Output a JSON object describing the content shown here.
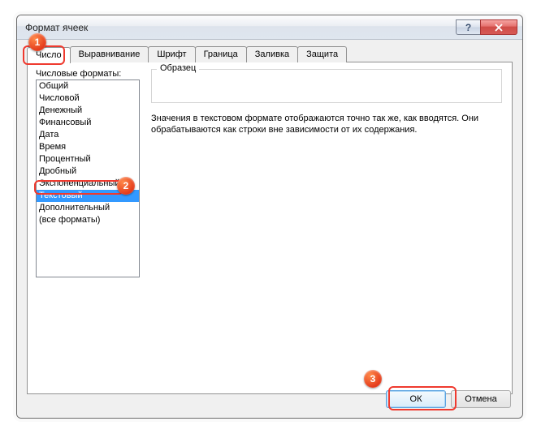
{
  "window": {
    "title": "Формат ячеек",
    "help_char": "?"
  },
  "tabs": {
    "t0": "Число",
    "t1": "Выравнивание",
    "t2": "Шрифт",
    "t3": "Граница",
    "t4": "Заливка",
    "t5": "Защита"
  },
  "formats_label": "Числовые форматы:",
  "formats": {
    "f0": "Общий",
    "f1": "Числовой",
    "f2": "Денежный",
    "f3": "Финансовый",
    "f4": "Дата",
    "f5": "Время",
    "f6": "Процентный",
    "f7": "Дробный",
    "f8": "Экспоненциальный",
    "f9": "Текстовый",
    "f10": "Дополнительный",
    "f11": "(все форматы)"
  },
  "sample_label": "Образец",
  "description": "Значения в текстовом формате отображаются точно так же, как вводятся. Они обрабатываются как строки вне зависимости от их содержания.",
  "buttons": {
    "ok": "ОК",
    "cancel": "Отмена"
  },
  "annotations": {
    "a1": "1",
    "a2": "2",
    "a3": "3"
  }
}
